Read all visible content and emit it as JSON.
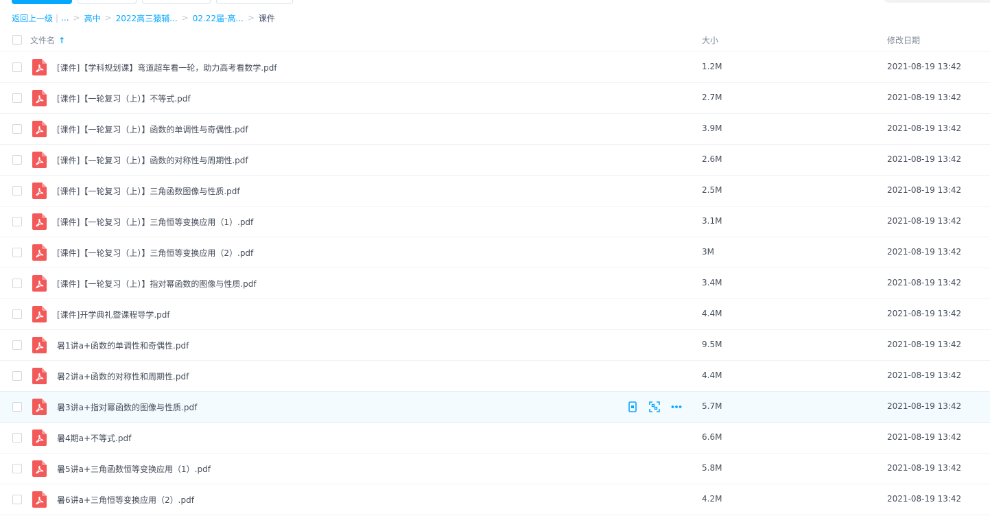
{
  "breadcrumb": {
    "back": "返回上一级",
    "ellipsis": "...",
    "items": [
      "高中",
      "2022高三猿辅...",
      "02.22届-高..."
    ],
    "current": "课件"
  },
  "table": {
    "headers": {
      "name": "文件名",
      "size": "大小",
      "date": "修改日期"
    },
    "rows": [
      {
        "name": "[课件]【学科规划课】弯道超车看一轮，助力高考看数学.pdf",
        "size": "1.2M",
        "date": "2021-08-19 13:42"
      },
      {
        "name": "[课件]【一轮复习（上）】不等式.pdf",
        "size": "2.7M",
        "date": "2021-08-19 13:42"
      },
      {
        "name": "[课件]【一轮复习（上）】函数的单调性与奇偶性.pdf",
        "size": "3.9M",
        "date": "2021-08-19 13:42"
      },
      {
        "name": "[课件]【一轮复习（上）】函数的对称性与周期性.pdf",
        "size": "2.6M",
        "date": "2021-08-19 13:42"
      },
      {
        "name": "[课件]【一轮复习（上）】三角函数图像与性质.pdf",
        "size": "2.5M",
        "date": "2021-08-19 13:42"
      },
      {
        "name": "[课件]【一轮复习（上）】三角恒等变换应用（1）.pdf",
        "size": "3.1M",
        "date": "2021-08-19 13:42"
      },
      {
        "name": "[课件]【一轮复习（上）】三角恒等变换应用（2）.pdf",
        "size": "3M",
        "date": "2021-08-19 13:42"
      },
      {
        "name": "[课件]【一轮复习（上）】指对幂函数的图像与性质.pdf",
        "size": "3.4M",
        "date": "2021-08-19 13:42"
      },
      {
        "name": "[课件]开学典礼暨课程导学.pdf",
        "size": "4.4M",
        "date": "2021-08-19 13:42"
      },
      {
        "name": "暑1讲a+函数的单调性和奇偶性.pdf",
        "size": "9.5M",
        "date": "2021-08-19 13:42"
      },
      {
        "name": "暑2讲a+函数的对称性和周期性.pdf",
        "size": "4.4M",
        "date": "2021-08-19 13:42"
      },
      {
        "name": "暑3讲a+指对幂函数的图像与性质.pdf",
        "size": "5.7M",
        "date": "2021-08-19 13:42"
      },
      {
        "name": "暑4期a+不等式.pdf",
        "size": "6.6M",
        "date": "2021-08-19 13:42"
      },
      {
        "name": "暑5讲a+三角函数恒等变换应用（1）.pdf",
        "size": "5.8M",
        "date": "2021-08-19 13:42"
      },
      {
        "name": "暑6讲a+三角恒等变换应用（2）.pdf",
        "size": "4.2M",
        "date": "2021-08-19 13:42"
      }
    ],
    "hover_row_index": 11
  },
  "colors": {
    "accent": "#06a7ff",
    "pdf_icon": "#f25a5a",
    "hover_bg": "#f4fbff"
  },
  "icons": {
    "file": "pdf-file-icon",
    "actions": [
      "phone-icon",
      "qr-scan-icon",
      "more-icon"
    ]
  }
}
